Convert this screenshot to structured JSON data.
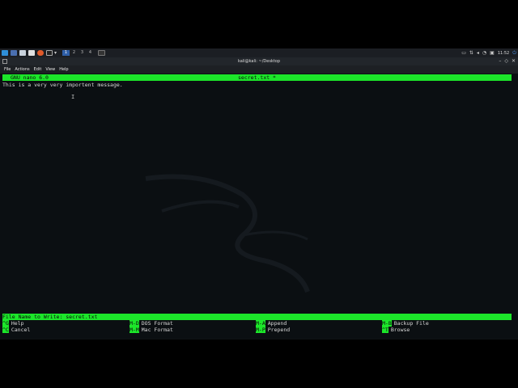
{
  "panel": {
    "workspaces": [
      "1",
      "2",
      "3",
      "4"
    ],
    "active_workspace": 0,
    "clock": "11:52"
  },
  "window": {
    "title": "kali@kali: ~/Desktop"
  },
  "menubar": {
    "items": [
      "File",
      "Actions",
      "Edit",
      "View",
      "Help"
    ]
  },
  "nano": {
    "version": "GNU nano 6.0",
    "filename": "secret.txt *",
    "content_line": "This is a very very importent message.",
    "prompt": "File Name to Write: secret.txt",
    "shortcuts": [
      {
        "key": "^G",
        "label": "Help"
      },
      {
        "key": "M-D",
        "label": "DOS Format"
      },
      {
        "key": "M-A",
        "label": "Append"
      },
      {
        "key": "M-B",
        "label": "Backup File"
      },
      {
        "key": "^C",
        "label": "Cancel"
      },
      {
        "key": "M-M",
        "label": "Mac Format"
      },
      {
        "key": "M-P",
        "label": "Prepend"
      },
      {
        "key": "^T",
        "label": "Browse"
      }
    ]
  },
  "colors": {
    "nano_green": "#1ce62a",
    "terminal_bg": "#0b0f12",
    "text": "#d8d8d8"
  }
}
